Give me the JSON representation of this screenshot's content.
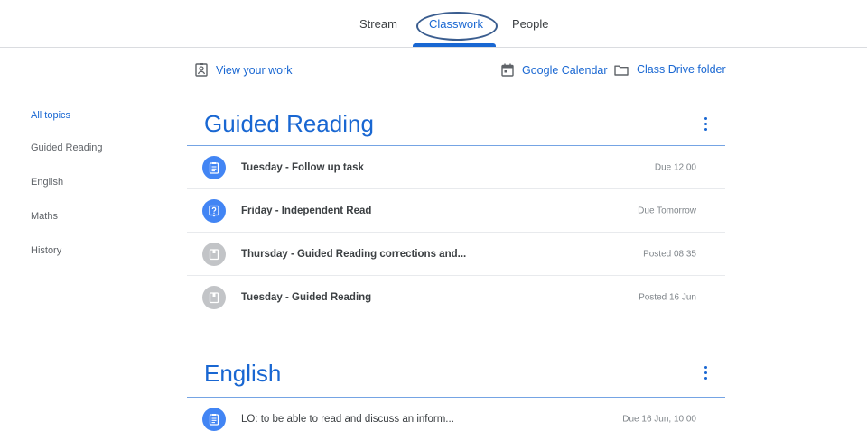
{
  "nav": {
    "tabs": [
      {
        "label": "Stream"
      },
      {
        "label": "Classwork"
      },
      {
        "label": "People"
      }
    ]
  },
  "actions": {
    "view_work": "View your work",
    "calendar": "Google Calendar",
    "drive": "Class Drive folder"
  },
  "sidebar": {
    "items": [
      {
        "label": "All topics",
        "active": true
      },
      {
        "label": "Guided Reading"
      },
      {
        "label": "English"
      },
      {
        "label": "Maths"
      },
      {
        "label": "History"
      }
    ]
  },
  "topics": [
    {
      "title": "Guided Reading",
      "items": [
        {
          "icon": "assignment-icon",
          "icon_color": "#4285f4",
          "title": "Tuesday - Follow up task",
          "status": "Due 12:00"
        },
        {
          "icon": "question-icon",
          "icon_color": "#4285f4",
          "title": "Friday - Independent Read",
          "status": "Due Tomorrow"
        },
        {
          "icon": "material-icon",
          "icon_color": "#c2c4c7",
          "title": "Thursday - Guided Reading corrections and...",
          "status": "Posted 08:35"
        },
        {
          "icon": "material-icon",
          "icon_color": "#c2c4c7",
          "title": "Tuesday - Guided Reading",
          "status": "Posted 16 Jun"
        }
      ]
    },
    {
      "title": "English",
      "items": [
        {
          "icon": "assignment-icon",
          "icon_color": "#4285f4",
          "title": "LO: to be able to read and discuss an inform...",
          "status": "Due 16 Jun, 10:00"
        }
      ]
    }
  ],
  "colors": {
    "accent": "#1967d2",
    "assignment_blue": "#4285f4",
    "material_grey": "#c2c4c7"
  }
}
